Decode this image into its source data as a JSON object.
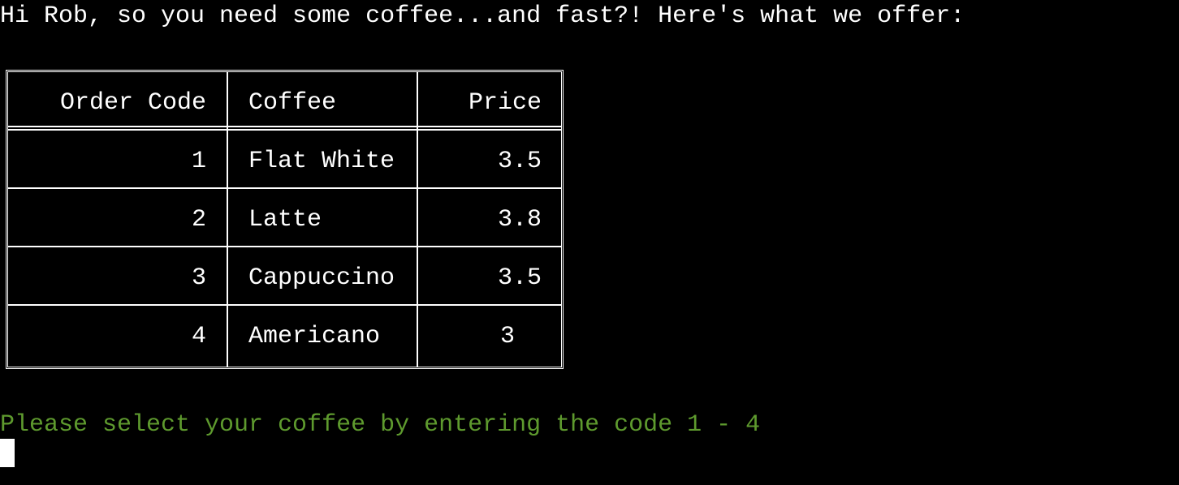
{
  "terminal": {
    "greeting": "Hi Rob, so you need some coffee...and fast?! Here's what we offer:",
    "prompt": "Please select your coffee by entering the code 1 - 4",
    "prompt_color": "#5e9a2e",
    "text_color": "#ffffff",
    "background": "#000000"
  },
  "menu_table": {
    "headers": [
      "Order Code",
      "Coffee",
      "Price"
    ],
    "rows": [
      [
        "1",
        "Flat White",
        "3.5"
      ],
      [
        "2",
        "Latte",
        "3.8"
      ],
      [
        "3",
        "Cappuccino",
        "3.5"
      ],
      [
        "4",
        "Americano",
        "3"
      ]
    ]
  }
}
